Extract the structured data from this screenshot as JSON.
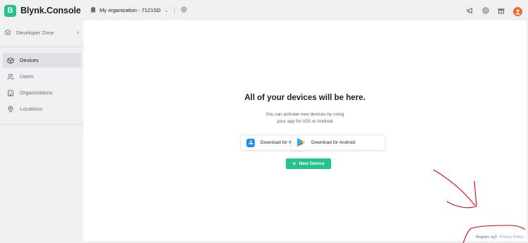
{
  "brand": {
    "logo_letter": "B",
    "name": "Blynk.Console",
    "accent": "#23c48e"
  },
  "sidebar": {
    "developer_zone": {
      "label": "Developer Zone",
      "icon": "developer-zone-icon"
    },
    "items": [
      {
        "label": "Devices",
        "icon": "cube-icon",
        "active": true
      },
      {
        "label": "Users",
        "icon": "users-icon",
        "active": false
      },
      {
        "label": "Organizations",
        "icon": "building-icon",
        "active": false
      },
      {
        "label": "Locations",
        "icon": "location-pin-icon",
        "active": false
      }
    ]
  },
  "topbar": {
    "organization": "My organization - 7121SD",
    "icons": [
      "megaphone-icon",
      "help-icon",
      "gift-icon",
      "user-avatar-icon"
    ]
  },
  "main": {
    "title": "All of your devices will be here.",
    "description_line1": "You can activate new devices by using",
    "description_line2": "your app for IOS or Android",
    "ios_button": "Download for IOS",
    "android_button": "Download for Android",
    "new_device_button": "New Device"
  },
  "footer": {
    "region": "Region: ny3",
    "privacy": "Privacy Policy"
  },
  "colors": {
    "background": "#eef0f2",
    "panel": "#ffffff",
    "primary": "#23c48e",
    "avatar": "#ef6c2e",
    "link": "#8c93e8",
    "annotation": "#d10b0b"
  }
}
